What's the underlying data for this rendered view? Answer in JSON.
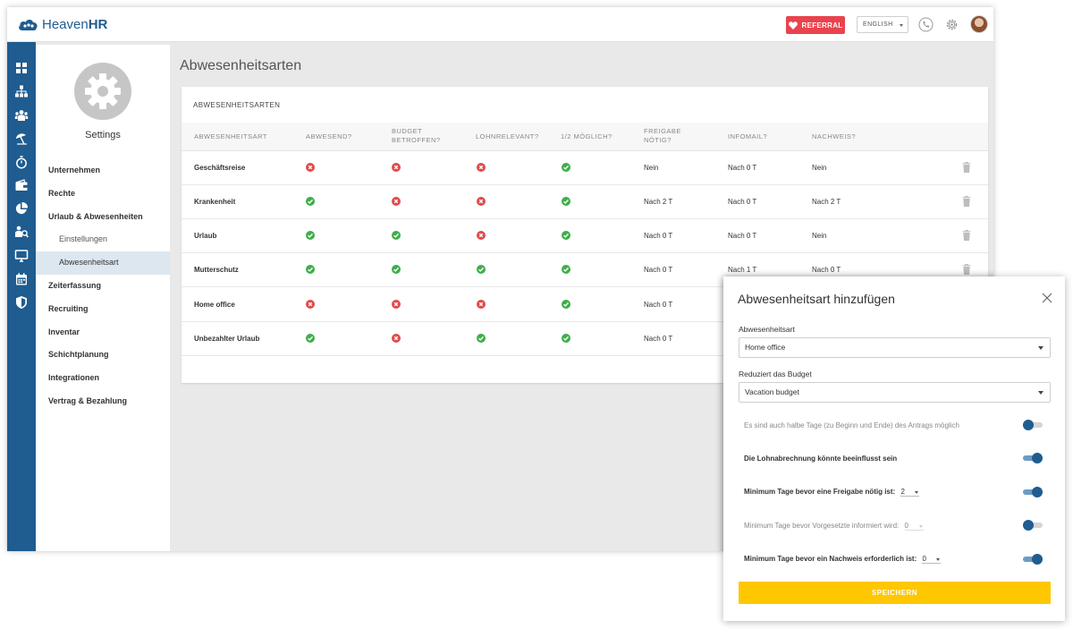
{
  "brand": {
    "name_light": "Heaven",
    "name_bold": "HR"
  },
  "topbar": {
    "referral_label": "REFERRAL",
    "language": "ENGLISH",
    "icons": [
      "phone-icon",
      "gear-icon",
      "avatar"
    ]
  },
  "rail": {
    "icons": [
      "dashboard-icon",
      "org-chart-icon",
      "people-icon",
      "vacation-icon",
      "stopwatch-icon",
      "wallet-icon",
      "pie-chart-icon",
      "recruiting-icon",
      "monitor-icon",
      "calendar-icon",
      "shield-icon"
    ]
  },
  "settings": {
    "title": "Settings",
    "menu": [
      {
        "label": "Unternehmen",
        "level": 1
      },
      {
        "label": "Rechte",
        "level": 1
      },
      {
        "label": "Urlaub & Abwesenheiten",
        "level": 1
      },
      {
        "label": "Einstellungen",
        "level": 2
      },
      {
        "label": "Abwesenheitsart",
        "level": 2,
        "active": true
      },
      {
        "label": "Zeiterfassung",
        "level": 1
      },
      {
        "label": "Recruiting",
        "level": 1
      },
      {
        "label": "Inventar",
        "level": 1
      },
      {
        "label": "Schichtplanung",
        "level": 1
      },
      {
        "label": "Integrationen",
        "level": 1
      },
      {
        "label": "Vertrag & Bezahlung",
        "level": 1
      }
    ]
  },
  "page": {
    "title": "Abwesenheitsarten"
  },
  "table": {
    "card_title": "ABWESENHEITSARTEN",
    "headers": {
      "type": "ABWESENHEITSART",
      "absent": "ABWESEND?",
      "budget_1": "BUDGET",
      "budget_2": "BETROFFEN?",
      "payroll": "LOHNRELEVANT?",
      "half": "1/2 MÖGLICH?",
      "approval_1": "FREIGABE",
      "approval_2": "NÖTIG?",
      "infomail": "INFOMAIL?",
      "proof": "NACHWEIS?"
    },
    "rows": [
      {
        "name": "Geschäftsreise",
        "absent": false,
        "budget": false,
        "payroll": false,
        "half": true,
        "approval": "Nein",
        "infomail": "Nach 0 T",
        "proof": "Nein"
      },
      {
        "name": "Krankenheit",
        "absent": true,
        "budget": false,
        "payroll": false,
        "half": true,
        "approval": "Nach 2 T",
        "infomail": "Nach 0 T",
        "proof": "Nach 2 T"
      },
      {
        "name": "Urlaub",
        "absent": true,
        "budget": true,
        "payroll": false,
        "half": true,
        "approval": "Nach 0 T",
        "infomail": "Nach 0 T",
        "proof": "Nein"
      },
      {
        "name": "Mutterschutz",
        "absent": true,
        "budget": true,
        "payroll": true,
        "half": true,
        "approval": "Nach 0 T",
        "infomail": "Nach 1 T",
        "proof": "Nach 0 T"
      },
      {
        "name": "Home office",
        "absent": false,
        "budget": false,
        "payroll": false,
        "half": true,
        "approval": "Nach 0 T",
        "infomail": "",
        "proof": ""
      },
      {
        "name": "Unbezahlter Urlaub",
        "absent": true,
        "budget": false,
        "payroll": true,
        "half": true,
        "approval": "Nach 0 T",
        "infomail": "",
        "proof": ""
      }
    ]
  },
  "modal": {
    "title": "Abwesenheitsart hinzufügen",
    "type_label": "Abwesenheitsart",
    "type_value": "Home office",
    "budget_label": "Reduziert das Budget",
    "budget_value": "Vacation budget",
    "options": [
      {
        "label": "Es sind auch halbe Tage (zu Beginn und Ende) des Antrags möglich",
        "value": "",
        "on": false
      },
      {
        "label": "Die Lohnabrechnung könnte beeinflusst sein",
        "value": "",
        "on": true
      },
      {
        "label": "Minimum Tage bevor eine Freigabe nötig ist:",
        "value": "2",
        "on": true
      },
      {
        "label": "Minimum Tage bevor Vorgesetzte informiert wird:",
        "value": "0",
        "on": false
      },
      {
        "label": "Minimum Tage bevor ein Nachweis erforderlich ist:",
        "value": "0",
        "on": true
      }
    ],
    "save_label": "SPEICHERN"
  },
  "colors": {
    "brand_blue": "#1f5c8f",
    "referral_red": "#e9434d",
    "save_yellow": "#fec700",
    "check_green": "#3fae49",
    "cross_red": "#e04b4b"
  }
}
